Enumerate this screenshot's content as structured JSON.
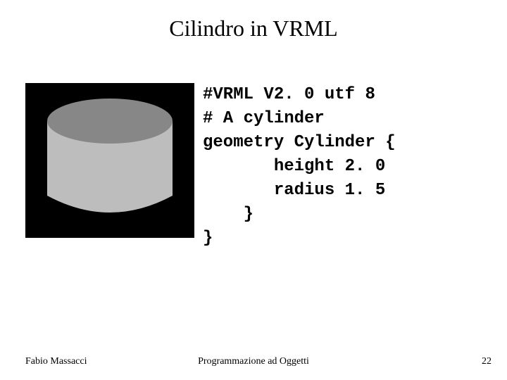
{
  "title": "Cilindro in VRML",
  "code": {
    "l1": "#VRML V2. 0 utf 8",
    "l2": "# A cylinder",
    "l3": "geometry Cylinder {",
    "l4": "       height 2. 0",
    "l5": "       radius 1. 5",
    "l6": "    }",
    "l7": "}"
  },
  "footer": {
    "author": "Fabio Massacci",
    "course": "Programmazione ad Oggetti",
    "page": "22"
  }
}
